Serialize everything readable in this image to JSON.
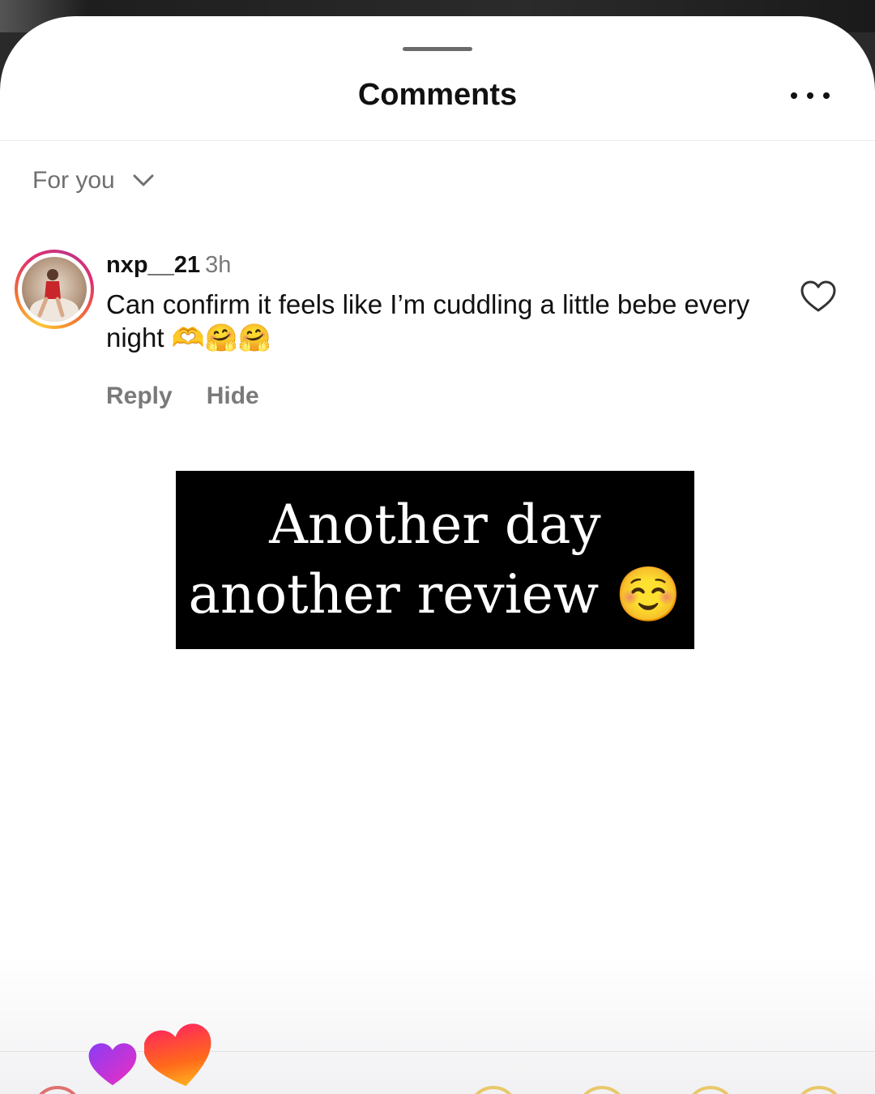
{
  "header": {
    "title": "Comments",
    "more_icon": "more-horizontal-icon"
  },
  "sort": {
    "label": "For you",
    "icon": "chevron-down-icon"
  },
  "comment": {
    "username": "nxp__21",
    "time": "3h",
    "text": "Can confirm it feels like I’m cuddling a little bebe every night 🫶🤗🤗",
    "reply_label": "Reply",
    "hide_label": "Hide",
    "like_icon": "heart-outline-icon"
  },
  "banner": {
    "line1": "Another day",
    "line2": "another review",
    "emoji": "☺️"
  },
  "reaction_icons": [
    "purple-heart-icon",
    "orange-heart-icon"
  ],
  "colors": {
    "banner_bg": "#000000",
    "text": "#111111",
    "muted": "#7a7a7a"
  }
}
